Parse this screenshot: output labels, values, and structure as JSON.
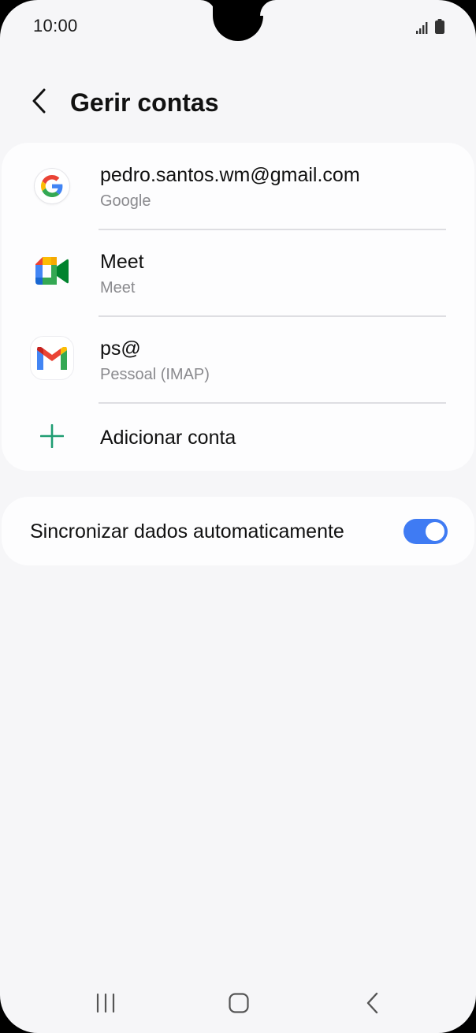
{
  "status_bar": {
    "time": "10:00",
    "icons": [
      "signal-icon",
      "battery-icon"
    ]
  },
  "header": {
    "back_icon": "chevron-left-icon",
    "title": "Gerir contas"
  },
  "accounts": [
    {
      "icon": "google-icon",
      "title": "pedro.santos.wm@gmail.com",
      "subtitle": "Google"
    },
    {
      "icon": "google-meet-icon",
      "title": "Meet",
      "subtitle": "Meet"
    },
    {
      "icon": "gmail-icon",
      "title": "ps@",
      "subtitle": "Pessoal (IMAP)"
    }
  ],
  "add_account": {
    "icon": "plus-icon",
    "label": "Adicionar conta"
  },
  "sync": {
    "label": "Sincronizar dados automaticamente",
    "enabled": true
  },
  "nav_bar": {
    "icons": [
      "recent-apps-icon",
      "home-icon",
      "back-icon"
    ]
  },
  "colors": {
    "background": "#f6f6f8",
    "card": "#fdfdfe",
    "accent_toggle": "#3f7bf3",
    "add_icon": "#1f9d72",
    "subtitle": "#8a8a8e"
  }
}
